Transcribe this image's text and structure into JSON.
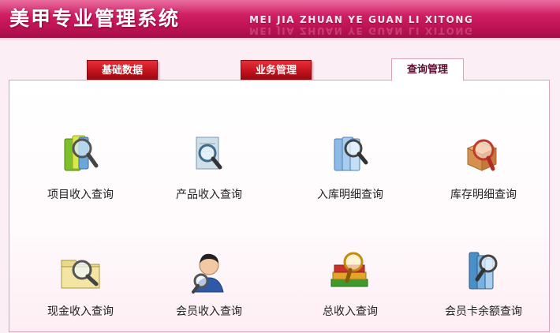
{
  "header": {
    "title": "美甲专业管理系统",
    "subtitle": "MEI JIA ZHUAN YE GUAN LI XITONG"
  },
  "tabs": [
    {
      "label": "基础数据",
      "active": false
    },
    {
      "label": "业务管理",
      "active": false
    },
    {
      "label": "查询管理",
      "active": true
    }
  ],
  "query_items": [
    {
      "label": "项目收入查询",
      "icon": "books-magnifier-icon"
    },
    {
      "label": "产品收入查询",
      "icon": "document-magnifier-icon"
    },
    {
      "label": "入库明细查询",
      "icon": "binders-magnifier-icon"
    },
    {
      "label": "库存明细查询",
      "icon": "box-magnifier-icon"
    },
    {
      "label": "现金收入查询",
      "icon": "folder-magnifier-icon"
    },
    {
      "label": "会员收入查询",
      "icon": "person-magnifier-icon"
    },
    {
      "label": "总收入查询",
      "icon": "book-stack-magnifier-icon"
    },
    {
      "label": "会员卡余额查询",
      "icon": "card-magnifier-icon"
    }
  ],
  "colors": {
    "header": "#c8185c",
    "tab_inactive": "#c4141e",
    "panel_border": "#d8a2bb"
  }
}
